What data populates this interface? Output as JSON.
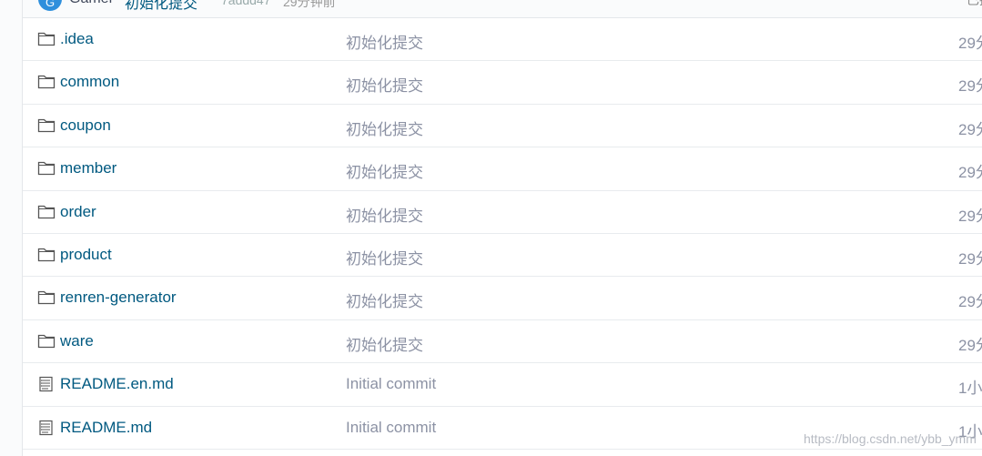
{
  "commit_bar": {
    "avatar_letter": "G",
    "author": "Gamer",
    "message": "初始化提交",
    "hash": "7addd47",
    "time": "29分钟前",
    "right_text": "已提交"
  },
  "files": [
    {
      "type": "folder",
      "icon": "folder-icon",
      "name": ".idea",
      "message": "初始化提交",
      "time": "29分"
    },
    {
      "type": "folder",
      "icon": "folder-icon",
      "name": "common",
      "message": "初始化提交",
      "time": "29分"
    },
    {
      "type": "folder",
      "icon": "folder-icon",
      "name": "coupon",
      "message": "初始化提交",
      "time": "29分"
    },
    {
      "type": "folder",
      "icon": "folder-icon",
      "name": "member",
      "message": "初始化提交",
      "time": "29分"
    },
    {
      "type": "folder",
      "icon": "folder-icon",
      "name": "order",
      "message": "初始化提交",
      "time": "29分"
    },
    {
      "type": "folder",
      "icon": "folder-icon",
      "name": "product",
      "message": "初始化提交",
      "time": "29分"
    },
    {
      "type": "folder",
      "icon": "folder-icon",
      "name": "renren-generator",
      "message": "初始化提交",
      "time": "29分"
    },
    {
      "type": "folder",
      "icon": "folder-icon",
      "name": "ware",
      "message": "初始化提交",
      "time": "29分"
    },
    {
      "type": "file",
      "icon": "file-text-icon",
      "name": "README.en.md",
      "message": "Initial commit",
      "time": "1小"
    },
    {
      "type": "file",
      "icon": "file-text-icon",
      "name": "README.md",
      "message": "Initial commit",
      "time": "1小"
    }
  ],
  "watermark": "https://blog.csdn.net/ybb_ymm"
}
